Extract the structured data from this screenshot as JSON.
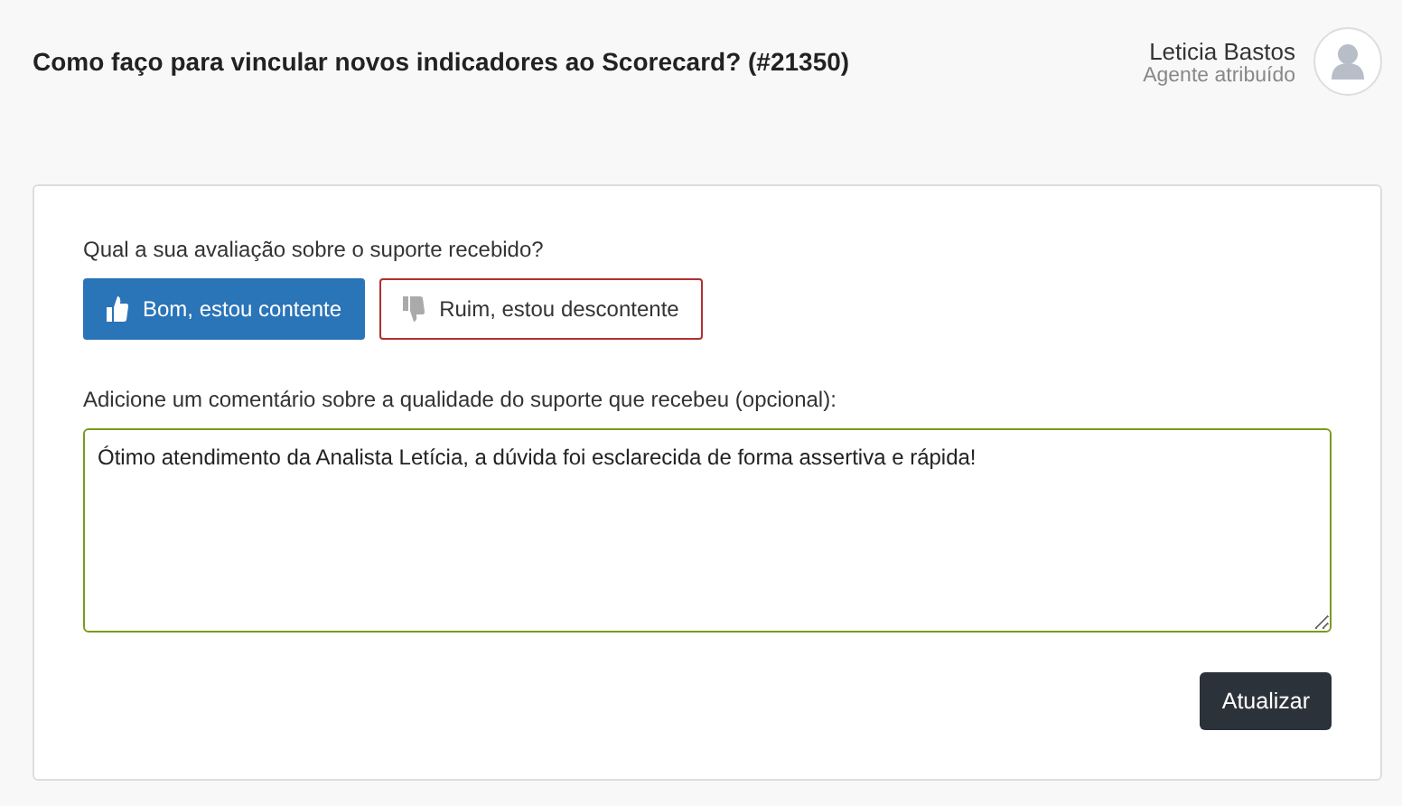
{
  "ticket": {
    "title": "Como faço para vincular novos indicadores ao Scorecard? (#21350)"
  },
  "agent": {
    "name": "Leticia Bastos",
    "role": "Agente atribuído"
  },
  "rating": {
    "question": "Qual a sua avaliação sobre o suporte recebido?",
    "options": [
      {
        "kind": "good",
        "label": "Bom, estou contente",
        "selected": true
      },
      {
        "kind": "bad",
        "label": "Ruim, estou descontente",
        "selected": false
      }
    ]
  },
  "comment": {
    "label": "Adicione um comentário sobre a qualidade do suporte que recebeu (opcional):",
    "value": "Ótimo atendimento da Analista Letícia, a dúvida foi esclarecida de forma assertiva e rápida!"
  },
  "buttons": [
    "Atualizar"
  ]
}
